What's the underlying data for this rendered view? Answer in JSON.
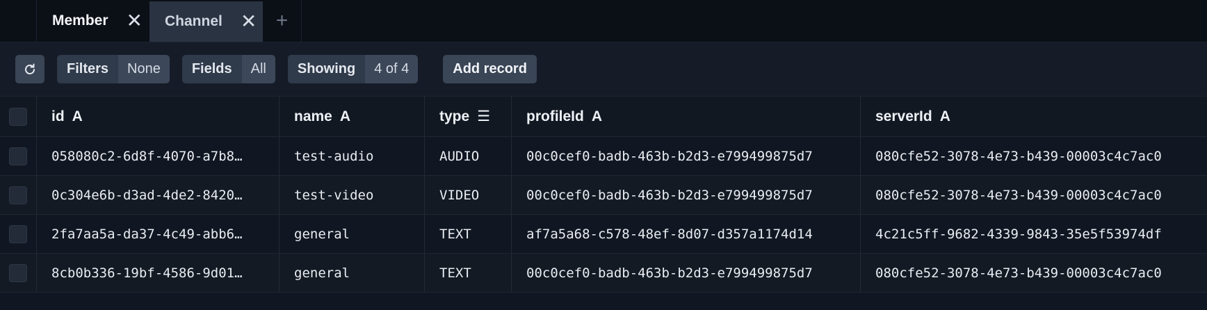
{
  "tabs": [
    {
      "label": "Member",
      "active": true
    },
    {
      "label": "Channel",
      "active": false
    }
  ],
  "tab_close_glyph": "✕",
  "tab_add_glyph": "+",
  "toolbar": {
    "filters_label": "Filters",
    "filters_value": "None",
    "fields_label": "Fields",
    "fields_value": "All",
    "showing_label": "Showing",
    "showing_value": "4 of 4",
    "add_record_label": "Add record"
  },
  "columns": [
    {
      "label": "id",
      "type_glyph": "A"
    },
    {
      "label": "name",
      "type_glyph": "A"
    },
    {
      "label": "type",
      "type_glyph": "☰"
    },
    {
      "label": "profileId",
      "type_glyph": "A"
    },
    {
      "label": "serverId",
      "type_glyph": "A"
    }
  ],
  "rows": [
    {
      "id": "058080c2-6d8f-4070-a7b8…",
      "name": "test-audio",
      "type": "AUDIO",
      "profileId": "00c0cef0-badb-463b-b2d3-e799499875d7",
      "serverId": "080cfe52-3078-4e73-b439-00003c4c7ac0"
    },
    {
      "id": "0c304e6b-d3ad-4de2-8420…",
      "name": "test-video",
      "type": "VIDEO",
      "profileId": "00c0cef0-badb-463b-b2d3-e799499875d7",
      "serverId": "080cfe52-3078-4e73-b439-00003c4c7ac0"
    },
    {
      "id": "2fa7aa5a-da37-4c49-abb6…",
      "name": "general",
      "type": "TEXT",
      "profileId": "af7a5a68-c578-48ef-8d07-d357a1174d14",
      "serverId": "4c21c5ff-9682-4339-9843-35e5f53974df"
    },
    {
      "id": "8cb0b336-19bf-4586-9d01…",
      "name": "general",
      "type": "TEXT",
      "profileId": "00c0cef0-badb-463b-b2d3-e799499875d7",
      "serverId": "080cfe52-3078-4e73-b439-00003c4c7ac0"
    }
  ],
  "colors": {
    "background": "#0f141d",
    "toolbar": "#161c27",
    "button": "#3a4556",
    "active_tab": "#2a3342"
  }
}
